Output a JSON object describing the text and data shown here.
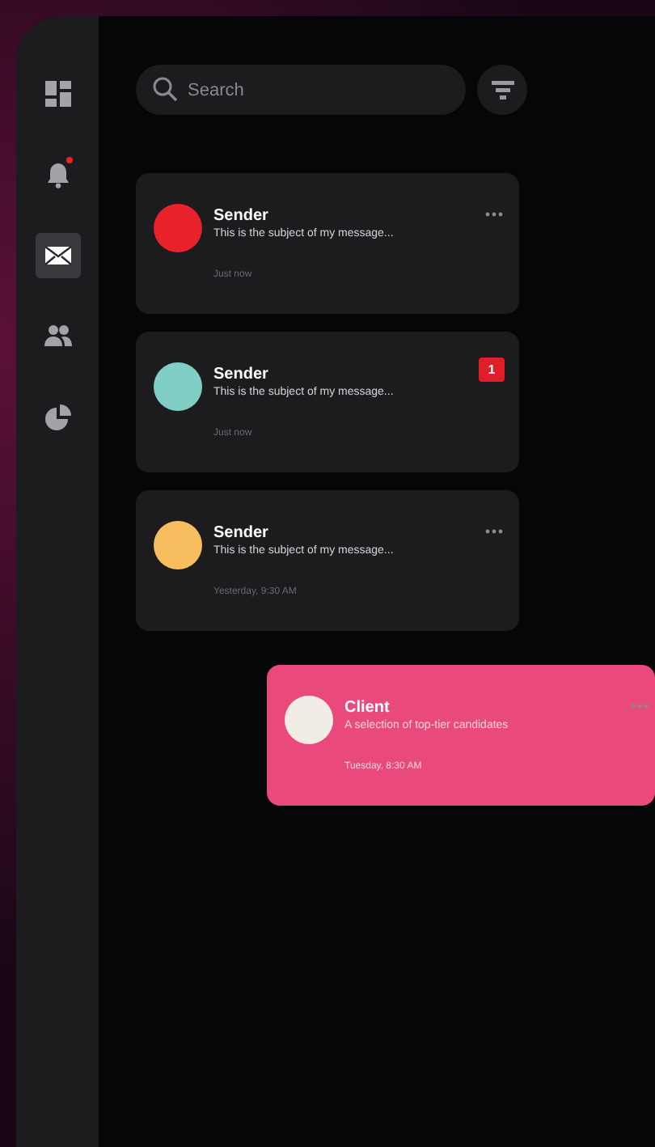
{
  "sidebar": {
    "items": [
      {
        "kind": "dashboard",
        "selected": false,
        "notification": false
      },
      {
        "kind": "bell",
        "selected": false,
        "notification": true
      },
      {
        "kind": "mail",
        "selected": true,
        "notification": false
      },
      {
        "kind": "people",
        "selected": false,
        "notification": false
      },
      {
        "kind": "pie",
        "selected": false,
        "notification": false
      }
    ]
  },
  "search": {
    "placeholder": "Search"
  },
  "messages": [
    {
      "sender": "Sender",
      "subject": "This is the subject of my message...",
      "time": "Just now",
      "color": "#e8212b",
      "swiped": false
    },
    {
      "sender": "Sender",
      "subject": "This is the subject of my message...",
      "time": "Just now",
      "color": "#7fcfc6",
      "badge": "1",
      "swiped": false
    },
    {
      "sender": "Sender",
      "subject": "This is the subject of my message...",
      "time": "Yesterday, 9:30 AM",
      "color": "#f8bd5f",
      "swiped": false
    },
    {
      "sender": "Client",
      "subject": "A selection of top-tier candidates",
      "time": "Tuesday, 8:30 AM",
      "color": "#f2ede4",
      "swiped": true
    }
  ]
}
